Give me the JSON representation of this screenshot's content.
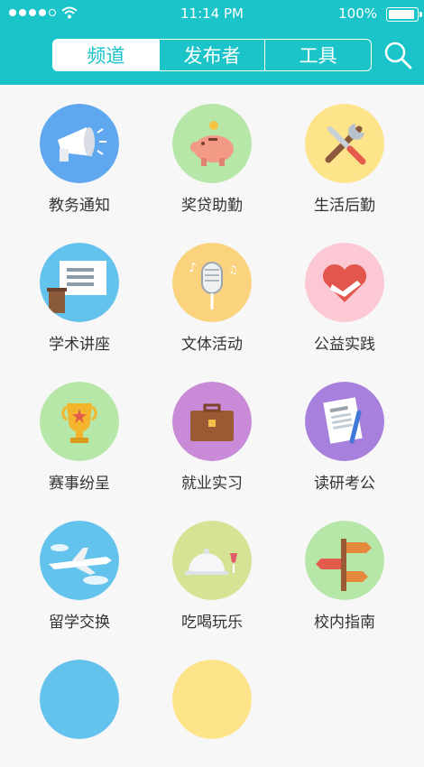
{
  "status_bar": {
    "time": "11:14 PM",
    "battery": "100%"
  },
  "tabs": [
    {
      "label": "频道",
      "active": true
    },
    {
      "label": "发布者",
      "active": false
    },
    {
      "label": "工具",
      "active": false
    }
  ],
  "colors": {
    "accent": "#1bc4c8"
  },
  "channels": [
    {
      "label": "教务通知",
      "icon": "megaphone-icon",
      "color": "#5fa8f0"
    },
    {
      "label": "奖贷助勤",
      "icon": "piggy-bank-icon",
      "color": "#b6e6a8"
    },
    {
      "label": "生活后勤",
      "icon": "tools-icon",
      "color": "#fde38a"
    },
    {
      "label": "学术讲座",
      "icon": "lecture-board-icon",
      "color": "#63c3ec"
    },
    {
      "label": "文体活动",
      "icon": "microphone-icon",
      "color": "#fbd37f"
    },
    {
      "label": "公益实践",
      "icon": "heart-hand-icon",
      "color": "#fbc8d4"
    },
    {
      "label": "赛事纷呈",
      "icon": "trophy-icon",
      "color": "#b6e6a8"
    },
    {
      "label": "就业实习",
      "icon": "briefcase-icon",
      "color": "#c98ad8"
    },
    {
      "label": "读研考公",
      "icon": "document-pen-icon",
      "color": "#a77fdc"
    },
    {
      "label": "留学交换",
      "icon": "airplane-icon",
      "color": "#63c3ec"
    },
    {
      "label": "吃喝玩乐",
      "icon": "dining-icon",
      "color": "#d5e394"
    },
    {
      "label": "校内指南",
      "icon": "signpost-icon",
      "color": "#b6e6a8"
    },
    {
      "label": "",
      "icon": "partial-icon",
      "color": "#63c3ec"
    },
    {
      "label": "",
      "icon": "partial-icon",
      "color": "#fde38a"
    }
  ]
}
